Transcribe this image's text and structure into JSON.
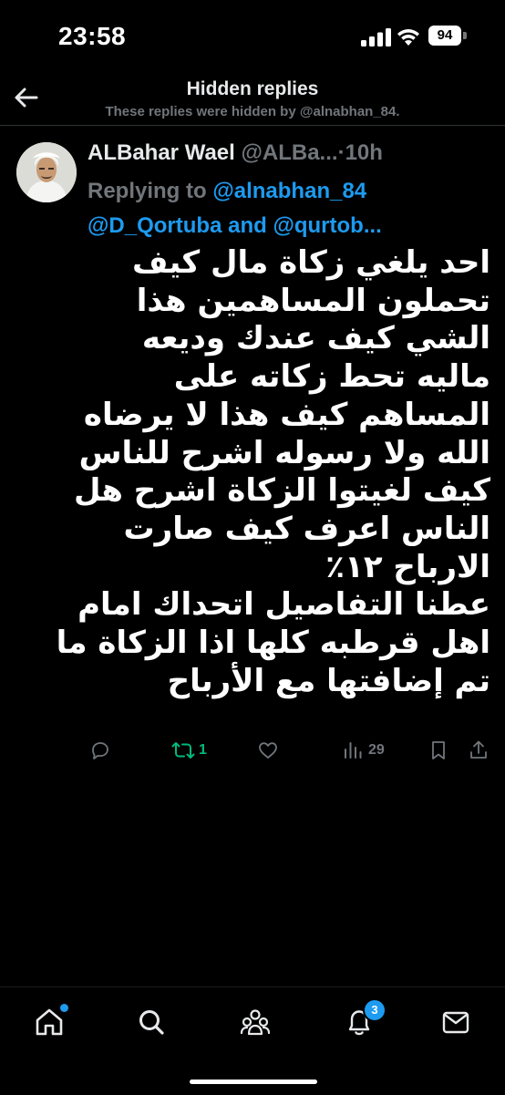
{
  "status_bar": {
    "time": "23:58",
    "battery": "94"
  },
  "header": {
    "title": "Hidden replies",
    "subtitle": "These replies were hidden by @alnabhan_84."
  },
  "tweet": {
    "author_name": "ALBahar Wael",
    "author_handle": "@ALBa...",
    "dot": "·",
    "time_ago": "10h",
    "replying_to_label": "Replying to",
    "mention_1": "@alnabhan_84",
    "mention_2": "@D_Qortuba",
    "mention_and": "and",
    "mention_3": "@qurtob...",
    "body_lines": [
      "احد يلغي زكاة مال كيف",
      "تحملون المساهمين هذا",
      "الشي كيف عندك وديعه",
      "ماليه تحط زكاته على",
      "المساهم كيف هذا لا يرضاه",
      "الله ولا رسوله اشرح للناس",
      "كيف لغيتوا الزكاة اشرح هل",
      "الناس اعرف كيف صارت",
      "الارباح ١٢٪",
      "عطنا التفاصيل اتحداك امام",
      "اهل قرطبه كلها اذا الزكاة ما",
      "تم إضافتها مع الأرباح"
    ],
    "actions": {
      "reply_icon": "reply-icon",
      "retweet_count": "1",
      "like_icon": "heart-icon",
      "views_count": "29",
      "bookmark_icon": "bookmark-icon",
      "share_icon": "share-icon"
    },
    "colors": {
      "retweet": "#00ba7c",
      "mention": "#1d9bf0",
      "muted": "#71767b"
    }
  },
  "bottom_nav": {
    "items": [
      "home-icon",
      "search-icon",
      "communities-icon",
      "notifications-icon",
      "messages-icon"
    ],
    "notifications_badge": "3"
  }
}
